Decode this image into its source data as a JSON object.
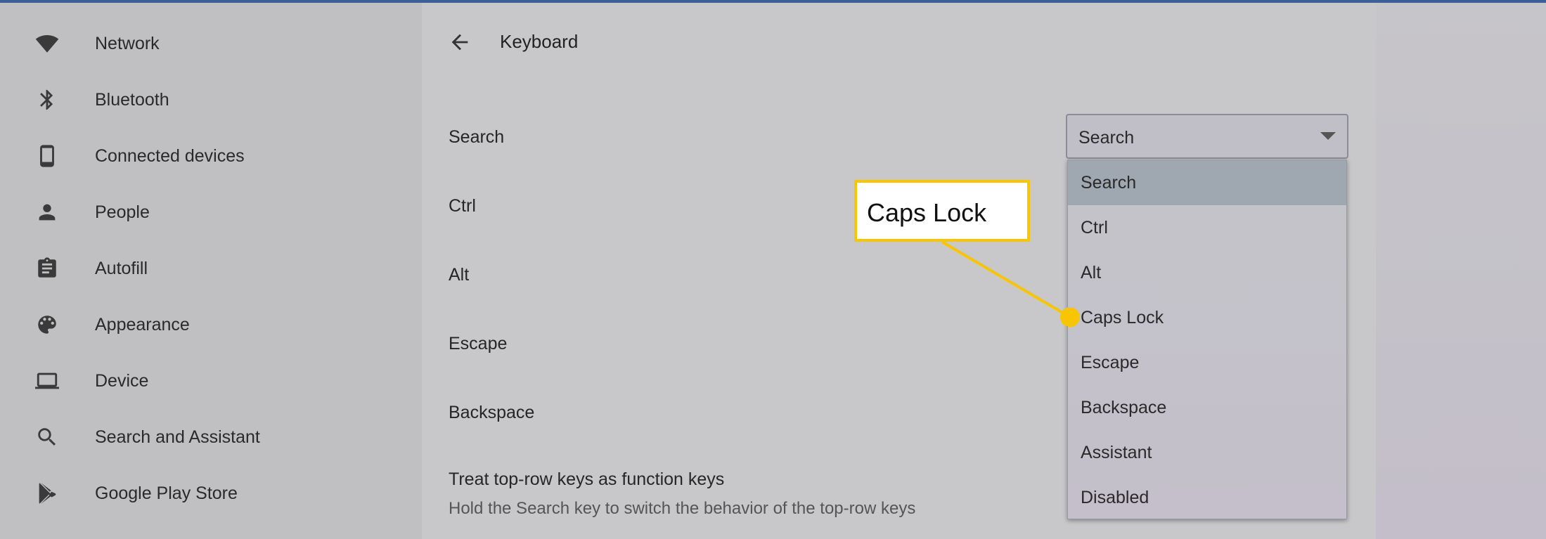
{
  "sidebar": {
    "items": [
      {
        "label": "Network",
        "icon": "wifi-icon"
      },
      {
        "label": "Bluetooth",
        "icon": "bluetooth-icon"
      },
      {
        "label": "Connected devices",
        "icon": "phone-icon"
      },
      {
        "label": "People",
        "icon": "person-icon"
      },
      {
        "label": "Autofill",
        "icon": "clipboard-icon"
      },
      {
        "label": "Appearance",
        "icon": "palette-icon"
      },
      {
        "label": "Device",
        "icon": "laptop-icon"
      },
      {
        "label": "Search and Assistant",
        "icon": "search-icon"
      },
      {
        "label": "Google Play Store",
        "icon": "play-store-icon"
      }
    ]
  },
  "main": {
    "title": "Keyboard",
    "rows": [
      "Search",
      "Ctrl",
      "Alt",
      "Escape",
      "Backspace"
    ],
    "top_row": {
      "title": "Treat top-row keys as function keys",
      "subtitle": "Hold the Search key to switch the behavior of the top-row keys"
    }
  },
  "select": {
    "value": "Search",
    "options": [
      "Search",
      "Ctrl",
      "Alt",
      "Caps Lock",
      "Escape",
      "Backspace",
      "Assistant",
      "Disabled"
    ],
    "selected_index": 0
  },
  "callout": {
    "text": "Caps Lock",
    "color": "#f7c600"
  }
}
